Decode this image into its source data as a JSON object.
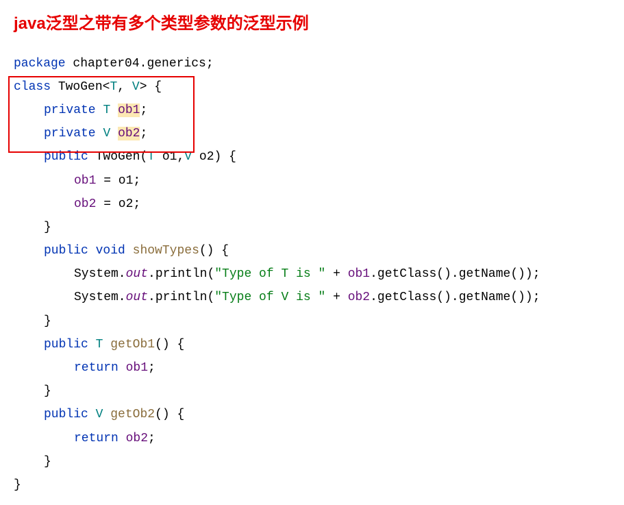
{
  "title": "java泛型之带有多个类型参数的泛型示例",
  "code": {
    "l0_kw": "package",
    "l0_rest": " chapter04.generics;",
    "l1_kw": "class",
    "l1_name": " TwoGen",
    "l1_lt": "<",
    "l1_t1": "T",
    "l1_comma": ", ",
    "l1_t2": "V",
    "l1_gt": ">",
    "l1_brace": " {",
    "l2_kw": "private",
    "l2_sp": " ",
    "l2_type": "T",
    "l2_sp2": " ",
    "l2_field": "ob1",
    "l2_semi": ";",
    "l3_kw": "private",
    "l3_sp": " ",
    "l3_type": "V",
    "l3_sp2": " ",
    "l3_field": "ob2",
    "l3_semi": ";",
    "l4_kw": "public",
    "l4_sp": " ",
    "l4_name": "TwoGen",
    "l4_sig1": "(",
    "l4_t1": "T",
    "l4_p1": " o1,",
    "l4_t2": "V",
    "l4_p2": " o2) {",
    "l5_f": "ob1",
    "l5_rest": " = o1;",
    "l6_f": "ob2",
    "l6_rest": " = o2;",
    "l7": "}",
    "l8_kw": "public",
    "l8_sp": " ",
    "l8_void": "void",
    "l8_sp2": " ",
    "l8_name": "showTypes",
    "l8_rest": "() {",
    "l9_a": "System.",
    "l9_out": "out",
    "l9_b": ".println(",
    "l9_str": "\"Type of T is \"",
    "l9_c": " + ",
    "l9_f": "ob1",
    "l9_d": ".getClass().getName());",
    "l10_a": "System.",
    "l10_out": "out",
    "l10_b": ".println(",
    "l10_str": "\"Type of V is \"",
    "l10_c": " + ",
    "l10_f": "ob2",
    "l10_d": ".getClass().getName());",
    "l11": "}",
    "l12_kw": "public",
    "l12_sp": " ",
    "l12_t": "T",
    "l12_sp2": " ",
    "l12_name": "getOb1",
    "l12_rest": "() {",
    "l13_kw": "return",
    "l13_sp": " ",
    "l13_f": "ob1",
    "l13_semi": ";",
    "l14": "}",
    "l15_kw": "public",
    "l15_sp": " ",
    "l15_t": "V",
    "l15_sp2": " ",
    "l15_name": "getOb2",
    "l15_rest": "() {",
    "l16_kw": "return",
    "l16_sp": " ",
    "l16_f": "ob2",
    "l16_semi": ";",
    "l17": "}",
    "l18": "}"
  }
}
